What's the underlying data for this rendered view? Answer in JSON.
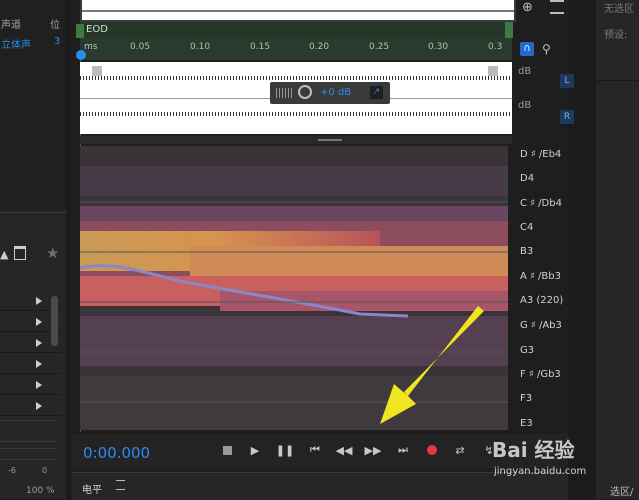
{
  "left_panel": {
    "channel_header": "声道",
    "pos_header": "位",
    "channel_value": "立体声",
    "channel_num": "3",
    "meter_labels": [
      "-6",
      "0"
    ],
    "meter_percent": "100 %"
  },
  "timeline": {
    "eod_label": "EOD",
    "ticks": [
      "ms",
      "0.05",
      "0.10",
      "0.15",
      "0.20",
      "0.25",
      "0.30",
      "0.3"
    ]
  },
  "waveform": {
    "gain": "+0 dB",
    "db_labels": [
      "dB",
      "dB"
    ],
    "channels": [
      "L",
      "R"
    ]
  },
  "pitch_notes": [
    "D ♯ /Eb4",
    "D4",
    "C ♯ /Db4",
    "C4",
    "B3",
    "A ♯ /Bb3",
    "A3 (220)",
    "G ♯ /Ab3",
    "G3",
    "F ♯ /Gb3",
    "F3",
    "E3"
  ],
  "transport": {
    "time": "0:00.000",
    "level_label": "电平",
    "selection_label": "选区/"
  },
  "right_panel": {
    "top_text": "无选区",
    "preset_label": "预设:"
  },
  "watermark": {
    "text": "Bai 经验",
    "url": "jingyan.baidu.com"
  }
}
